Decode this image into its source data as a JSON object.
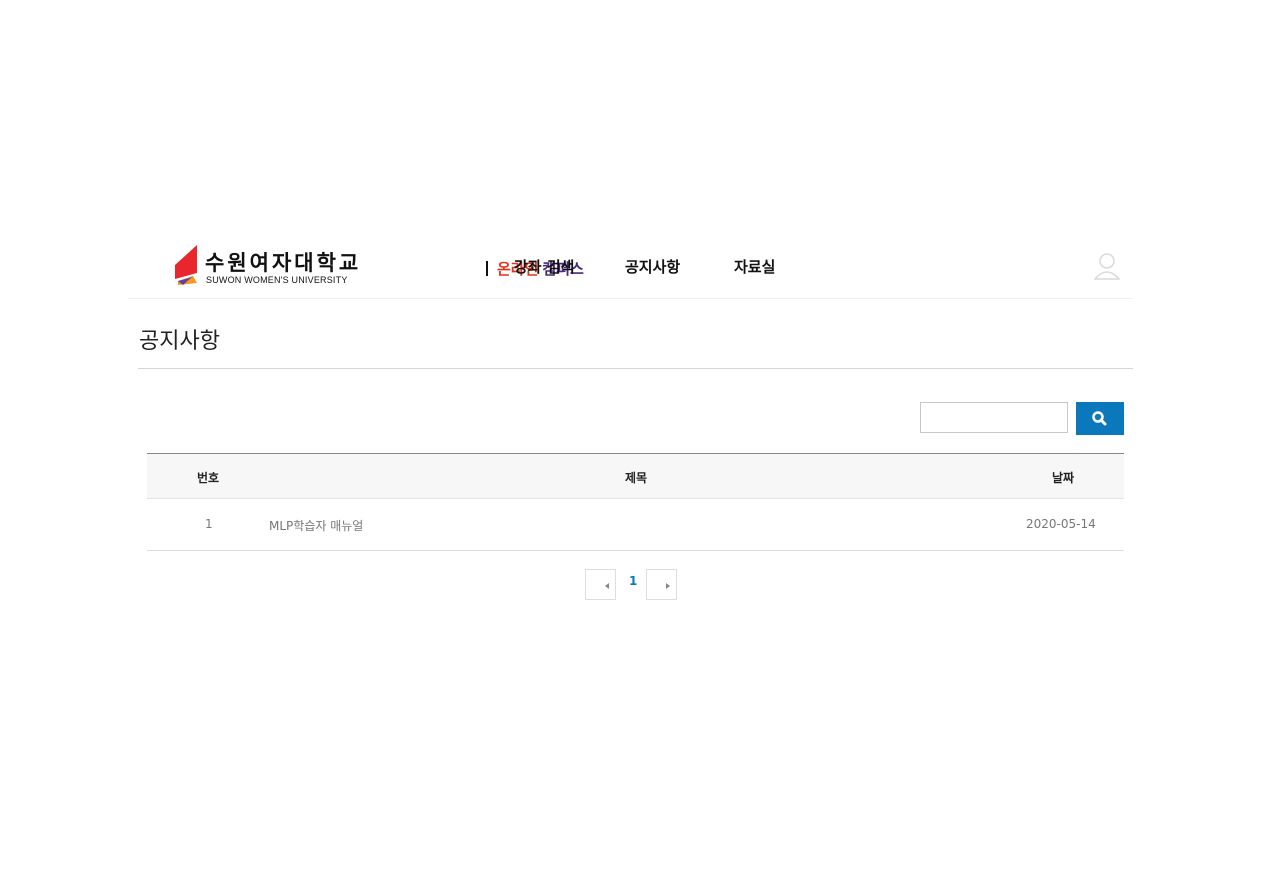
{
  "brand": {
    "name_kr": "수원여자대학교",
    "name_en": "SUWON WOMEN'S UNIVERSITY",
    "online": "온라인",
    "campus": "캠퍼스",
    "colors": {
      "red": "#e8262b",
      "orange": "#f39a1f",
      "purple": "#6a3c9c",
      "accent_red": "#e2341d"
    }
  },
  "nav": {
    "items": [
      {
        "label": "강좌 검색"
      },
      {
        "label": "공지사항"
      },
      {
        "label": "자료실"
      }
    ],
    "user_icon": "user-icon"
  },
  "page": {
    "title": "공지사항"
  },
  "search": {
    "placeholder": "",
    "value": "",
    "button_icon": "search-icon",
    "button_color": "#0b78bb"
  },
  "table": {
    "headers": {
      "no": "번호",
      "title": "제목",
      "date": "날짜"
    },
    "rows": [
      {
        "no": "1",
        "title": "MLP학습자 매뉴얼",
        "date": "2020-05-14"
      }
    ]
  },
  "pagination": {
    "current": "1",
    "prev_icon": "chevron-left-icon",
    "next_icon": "chevron-right-icon"
  }
}
